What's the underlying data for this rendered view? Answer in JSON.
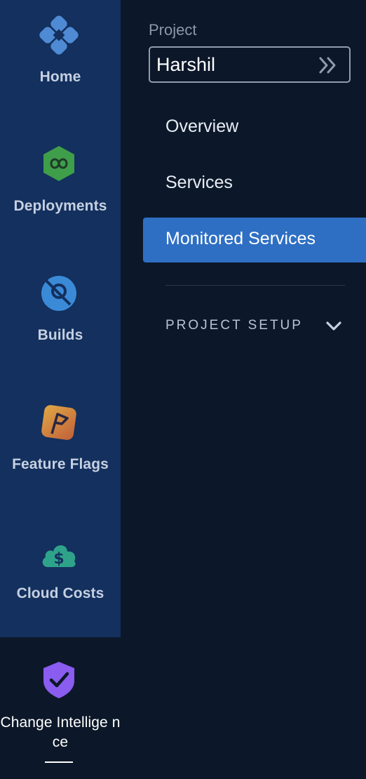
{
  "rail": {
    "items": [
      {
        "label": "Home",
        "icon": "home-icon"
      },
      {
        "label": "Deployments",
        "icon": "deployments-icon"
      },
      {
        "label": "Builds",
        "icon": "builds-icon"
      },
      {
        "label": "Feature Flags",
        "icon": "feature-flags-icon"
      },
      {
        "label": "Cloud Costs",
        "icon": "cloud-costs-icon"
      },
      {
        "label": "Change Intellige nce",
        "icon": "change-intelligence-icon",
        "active": true
      }
    ]
  },
  "project": {
    "label": "Project",
    "value": "Harshil"
  },
  "nav": {
    "overview": "Overview",
    "services": "Services",
    "monitored": "Monitored Services",
    "setup": "PROJECT SETUP"
  },
  "colors": {
    "rail_bg": "#13305e",
    "page_bg": "#0c1829",
    "active_item": "#2e6fc4"
  }
}
